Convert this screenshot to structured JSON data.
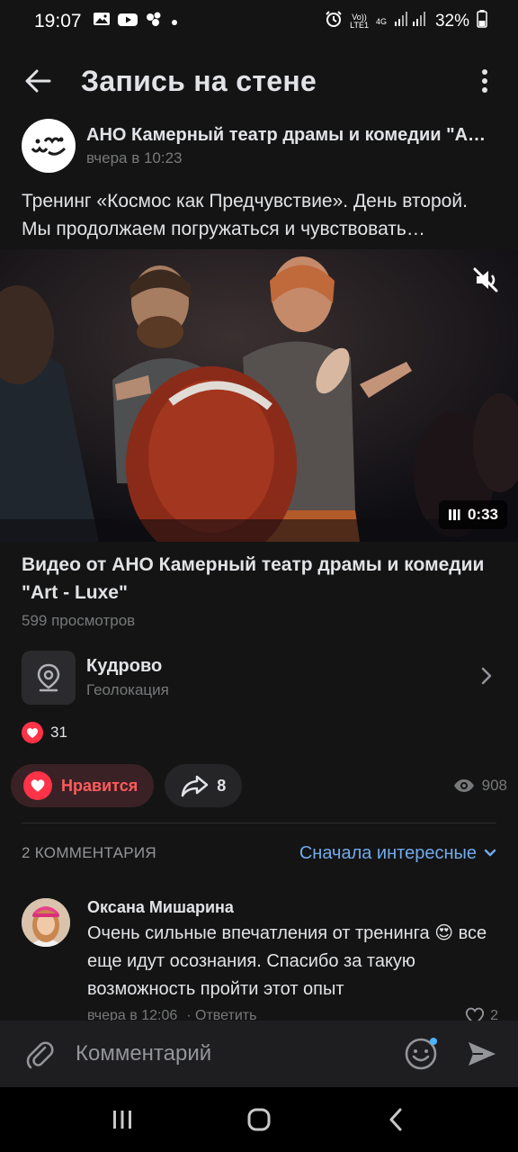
{
  "status_bar": {
    "time": "19:07",
    "battery": "32%",
    "network_top": "Vo))",
    "network_bottom": "LTE1",
    "network_gen": "4G",
    "icons": [
      "gallery-icon",
      "youtube-icon",
      "social-icon",
      "dot-icon",
      "alarm-icon",
      "signal-icon",
      "battery-icon"
    ]
  },
  "header": {
    "title": "Запись на стене",
    "icons": [
      "back-arrow-icon",
      "more-vertical-icon"
    ]
  },
  "post": {
    "author": "АНО Камерный театр драмы и комедии \"Art - Luxe\"",
    "time": "вчера в 10:23",
    "text": "Тренинг «Космос как Предчувствие». День второй. Мы продолжаем погружаться и чувствовать…"
  },
  "video": {
    "duration": "0:33",
    "title": "Видео от АНО Камерный театр драмы и комедии \"Art - Luxe\"",
    "views": "599 просмотров"
  },
  "geo": {
    "name": "Кудрово",
    "label": "Геолокация"
  },
  "stats": {
    "likes": "31",
    "like_label": "Нравится",
    "shares": "8",
    "views": "908"
  },
  "comments": {
    "count_label": "2 КОММЕНТАРИЯ",
    "sort_label": "Сначала интересные",
    "items": [
      {
        "author": "Оксана Мишарина",
        "text_before_emoji": "Очень сильные впечатления от тренинга",
        "emoji": "😍",
        "text_after_emoji": "все еще идут осознания. Спасибо за такую возможность пройти этот опыт",
        "time": "вчера в 12:06",
        "reply_label": "Ответить",
        "likes": "2"
      }
    ]
  },
  "composer": {
    "placeholder": "Комментарий"
  },
  "colors": {
    "background": "#141414",
    "accent_blue": "#71aaeb",
    "like_red": "#ff3347",
    "text_secondary": "#76787a"
  }
}
